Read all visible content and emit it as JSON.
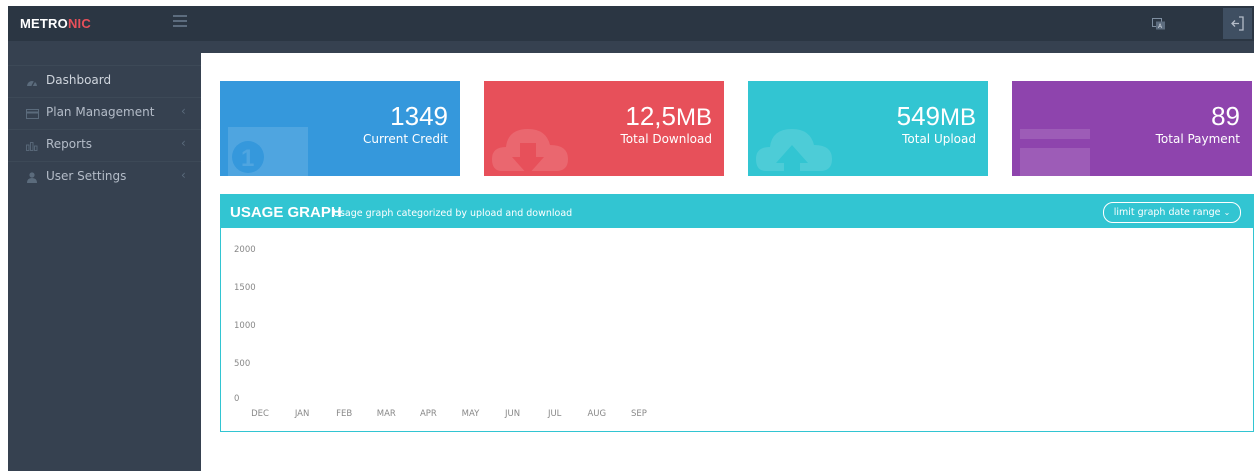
{
  "header": {
    "logo_main": "METRO",
    "logo_accent": "NIC"
  },
  "sidebar": {
    "items": [
      {
        "label": "Dashboard",
        "icon": "dashboard-icon"
      },
      {
        "label": "Plan Management",
        "icon": "credit-card-icon"
      },
      {
        "label": "Reports",
        "icon": "bar-chart-icon"
      },
      {
        "label": "User Settings",
        "icon": "user-icon"
      }
    ]
  },
  "stats": [
    {
      "value": "1349",
      "unit": "",
      "label": "Current Credit",
      "color": "#3598dc",
      "icon": "money-icon"
    },
    {
      "value": "12,5",
      "unit": "MB",
      "label": "Total Download",
      "color": "#e7505a",
      "icon": "cloud-download-icon"
    },
    {
      "value": "549",
      "unit": "MB",
      "label": "Total Upload",
      "color": "#32c5d2",
      "icon": "cloud-upload-icon"
    },
    {
      "value": "89",
      "unit": "",
      "label": "Total Payment",
      "color": "#8e44ad",
      "icon": "card-icon"
    }
  ],
  "panel": {
    "title": "USAGE GRAPH",
    "subtitle": "Usage graph categorized by upload and download",
    "range_button": "limit graph date range",
    "accent": "#32c5d2"
  },
  "chart_data": {
    "type": "line",
    "categories": [
      "DEC",
      "JAN",
      "FEB",
      "MAR",
      "APR",
      "MAY",
      "JUN",
      "JUL",
      "AUG",
      "SEP"
    ],
    "yticks": [
      "2000",
      "1500",
      "1000",
      "500",
      "0"
    ],
    "ylim": [
      0,
      2000
    ],
    "series": [],
    "grid": false
  }
}
